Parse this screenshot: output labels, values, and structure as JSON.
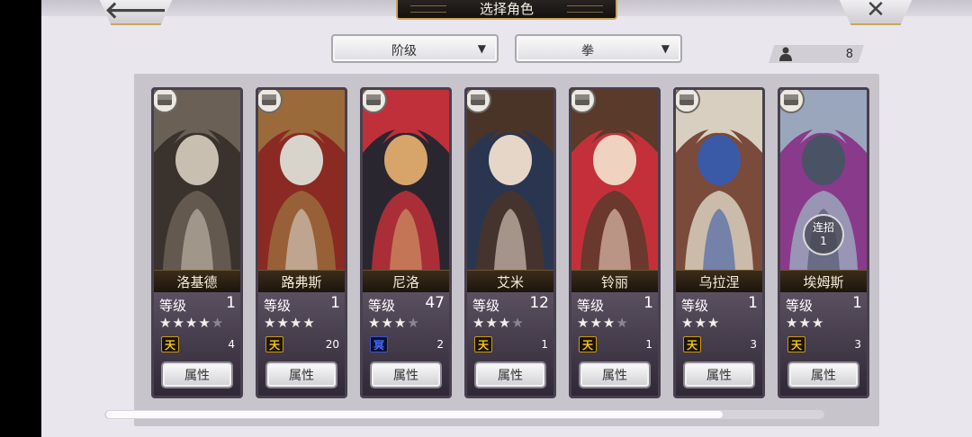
{
  "header": {
    "title": "选择角色",
    "back_label": "🡐",
    "close_label": "✕"
  },
  "filters": {
    "rank": {
      "label": "阶级",
      "arrow": "▼"
    },
    "weapon": {
      "label": "拳",
      "arrow": "▼"
    }
  },
  "counter": {
    "value": "8"
  },
  "combo": {
    "label": "连招",
    "value": "1"
  },
  "characters": [
    {
      "name": "洛基德",
      "level_label": "等级",
      "level": "1",
      "stars": 4,
      "max_stars": 5,
      "rank_glyph": "天",
      "rank_color": "gold",
      "count": "4",
      "attr_label": "属性",
      "colors": [
        "#6b6056",
        "#c9bfb0",
        "#3a322c"
      ]
    },
    {
      "name": "路弗斯",
      "level_label": "等级",
      "level": "1",
      "stars": 4,
      "max_stars": 4,
      "rank_glyph": "天",
      "rank_color": "gold",
      "count": "20",
      "attr_label": "属性",
      "colors": [
        "#9a6a3a",
        "#d8d4cc",
        "#8a2a22"
      ]
    },
    {
      "name": "尼洛",
      "level_label": "等级",
      "level": "47",
      "stars": 3,
      "max_stars": 4,
      "rank_glyph": "冥",
      "rank_color": "blue",
      "count": "2",
      "attr_label": "属性",
      "colors": [
        "#c0303a",
        "#d7a56a",
        "#2a2630"
      ]
    },
    {
      "name": "艾米",
      "level_label": "等级",
      "level": "12",
      "stars": 3,
      "max_stars": 4,
      "rank_glyph": "天",
      "rank_color": "gold",
      "count": "1",
      "attr_label": "属性",
      "colors": [
        "#4a3428",
        "#e5d6c8",
        "#2a3550"
      ]
    },
    {
      "name": "铃丽",
      "level_label": "等级",
      "level": "1",
      "stars": 3,
      "max_stars": 4,
      "rank_glyph": "天",
      "rank_color": "gold",
      "count": "1",
      "attr_label": "属性",
      "colors": [
        "#5a3a2a",
        "#f0d2c0",
        "#c4303a"
      ]
    },
    {
      "name": "乌拉涅",
      "level_label": "等级",
      "level": "1",
      "stars": 3,
      "max_stars": 3,
      "rank_glyph": "天",
      "rank_color": "gold",
      "count": "3",
      "attr_label": "属性",
      "colors": [
        "#d8cfc0",
        "#3a5aa8",
        "#7a4a3a"
      ]
    },
    {
      "name": "埃姆斯",
      "level_label": "等级",
      "level": "1",
      "stars": 3,
      "max_stars": 3,
      "rank_glyph": "天",
      "rank_color": "gold",
      "count": "3",
      "attr_label": "属性",
      "colors": [
        "#9aa6bc",
        "#4a5266",
        "#8a3a8a"
      ]
    }
  ],
  "scroll": {
    "position": 0.0,
    "visible_fraction": 0.86
  }
}
